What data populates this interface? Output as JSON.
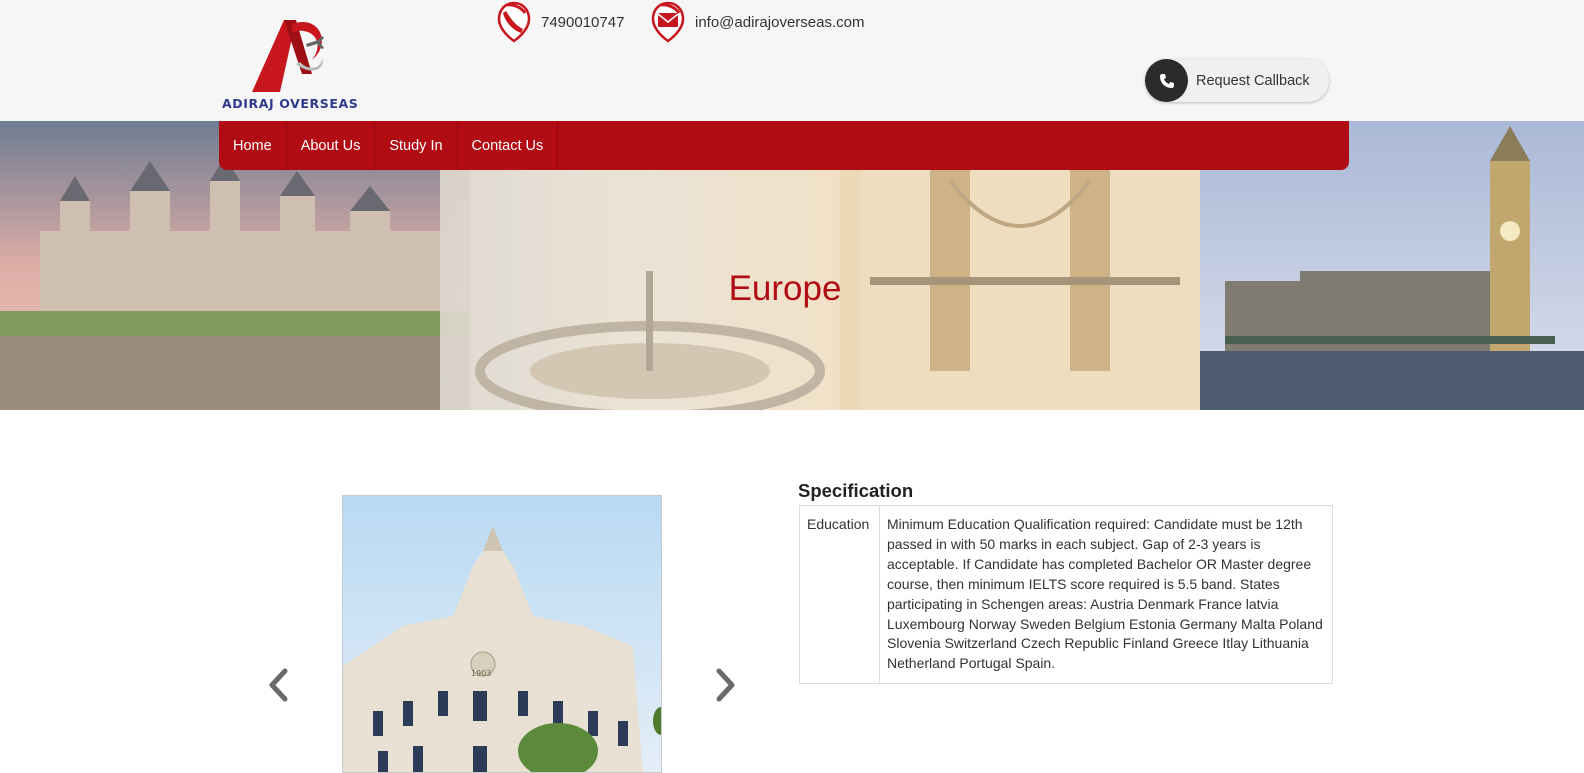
{
  "brand": {
    "name": "ADIRAJ OVERSEAS",
    "accent": "#b10c14",
    "navy": "#2e3b8c"
  },
  "contact": {
    "phone": "7490010747",
    "email": "info@adirajoverseas.com",
    "phone_icon": "phone-icon",
    "email_icon": "mail-icon"
  },
  "callback": {
    "label": "Request Callback",
    "icon": "phone-icon"
  },
  "nav": {
    "items": [
      {
        "label": "Home"
      },
      {
        "label": "About Us"
      },
      {
        "label": "Study In"
      },
      {
        "label": "Contact Us"
      }
    ]
  },
  "banner": {
    "title": "Europe"
  },
  "carousel": {
    "prev_icon": "chevron-left-icon",
    "next_icon": "chevron-right-icon",
    "image": "ornate-european-building-photo"
  },
  "specification": {
    "title": "Specification",
    "rows": [
      {
        "key": "Education",
        "value": "Minimum Education Qualification required: Candidate must be 12th passed in with 50 marks in each subject. Gap of 2-3 years is acceptable. If Candidate has completed Bachelor OR Master degree course, then minimum IELTS score required is 5.5 band. States participating in Schengen areas: Austria Denmark France latvia Luxembourg Norway Sweden Belgium Estonia Germany Malta Poland Slovenia Switzerland Czech Republic Finland Greece Itlay Lithuania Netherland Portugal Spain."
      }
    ]
  }
}
